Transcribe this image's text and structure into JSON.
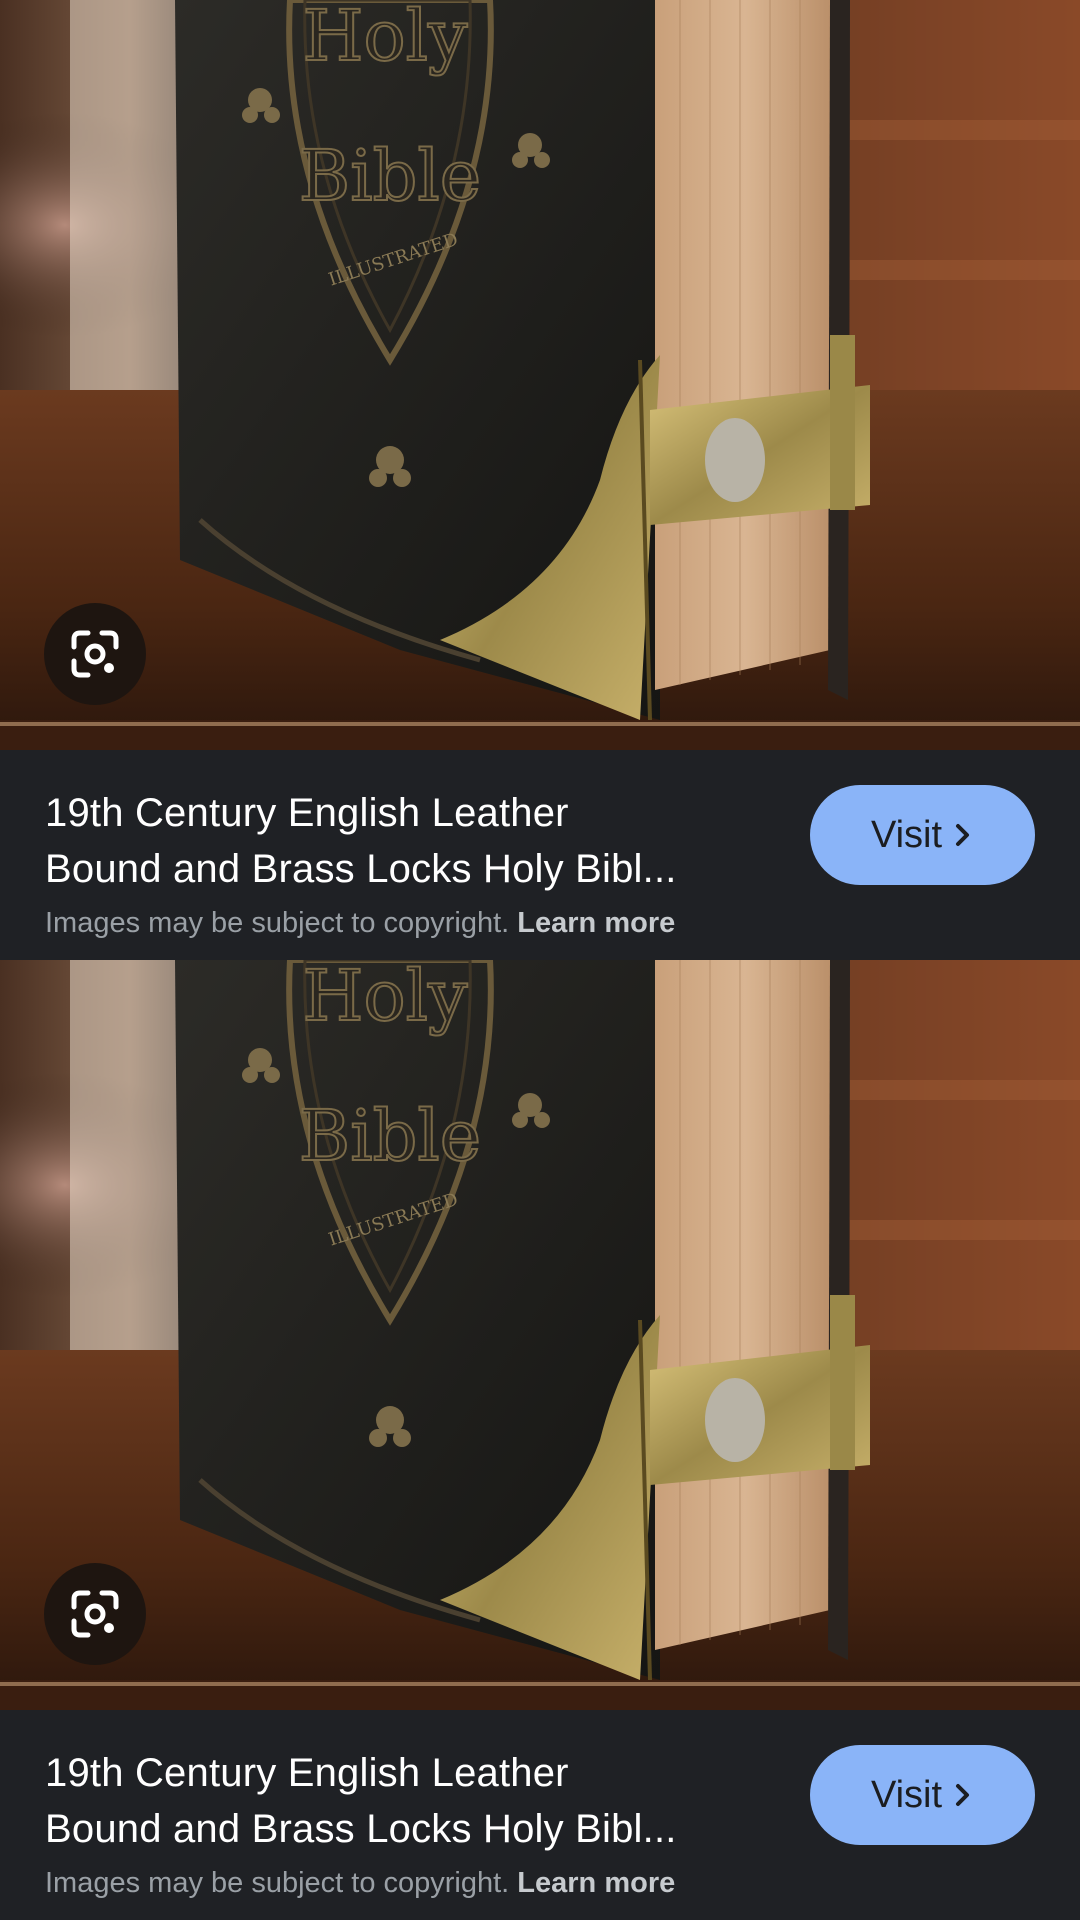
{
  "results": [
    {
      "title_line1": "19th Century English Leather",
      "title_line2": "Bound and Brass Locks Holy Bibl...",
      "copyright_text": "Images may be subject to copyright.",
      "learn_more": "Learn more",
      "visit_label": "Visit",
      "book_title_line1": "Holy",
      "book_title_line2": "Bible",
      "book_subtitle": "ILLUSTRATED"
    },
    {
      "title_line1": "19th Century English Leather",
      "title_line2": "Bound and Brass Locks Holy Bibl...",
      "copyright_text": "Images may be subject to copyright.",
      "learn_more": "Learn more",
      "visit_label": "Visit",
      "book_title_line1": "Holy",
      "book_title_line2": "Bible",
      "book_subtitle": "ILLUSTRATED"
    }
  ],
  "icons": {
    "lens": "google-lens-icon",
    "chevron": "chevron-right-icon"
  },
  "colors": {
    "info_background": "#1f2125",
    "visit_button": "#8ab4f8",
    "title_text": "#ffffff",
    "secondary_text": "#9aa0a6"
  }
}
